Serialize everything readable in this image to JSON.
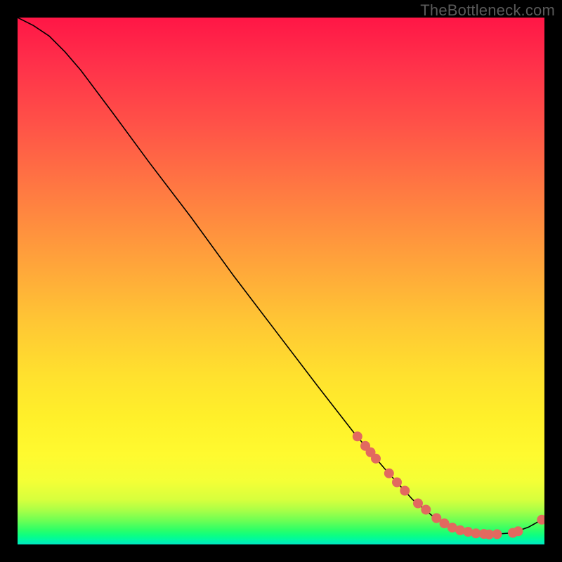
{
  "watermark": "TheBottleneck.com",
  "chart_data": {
    "type": "line",
    "title": "",
    "xlabel": "",
    "ylabel": "",
    "xlim": [
      0,
      100
    ],
    "ylim": [
      0,
      100
    ],
    "curve": [
      {
        "x": 0,
        "y": 100
      },
      {
        "x": 3,
        "y": 98.5
      },
      {
        "x": 6,
        "y": 96.5
      },
      {
        "x": 9,
        "y": 93.5
      },
      {
        "x": 12,
        "y": 90
      },
      {
        "x": 18,
        "y": 82
      },
      {
        "x": 25,
        "y": 72.5
      },
      {
        "x": 33,
        "y": 62
      },
      {
        "x": 41,
        "y": 51
      },
      {
        "x": 49,
        "y": 40.5
      },
      {
        "x": 57,
        "y": 30
      },
      {
        "x": 64,
        "y": 21
      },
      {
        "x": 70,
        "y": 14
      },
      {
        "x": 75,
        "y": 8.5
      },
      {
        "x": 79,
        "y": 5.2
      },
      {
        "x": 82.5,
        "y": 3.2
      },
      {
        "x": 86,
        "y": 2.2
      },
      {
        "x": 90,
        "y": 1.9
      },
      {
        "x": 94,
        "y": 2.2
      },
      {
        "x": 97,
        "y": 3.3
      },
      {
        "x": 99.5,
        "y": 4.7
      }
    ],
    "markers": [
      {
        "x": 64.5,
        "y": 20.5
      },
      {
        "x": 66.0,
        "y": 18.7
      },
      {
        "x": 67.0,
        "y": 17.5
      },
      {
        "x": 68.0,
        "y": 16.3
      },
      {
        "x": 70.5,
        "y": 13.5
      },
      {
        "x": 72.0,
        "y": 11.8
      },
      {
        "x": 73.5,
        "y": 10.2
      },
      {
        "x": 76.0,
        "y": 7.8
      },
      {
        "x": 77.5,
        "y": 6.6
      },
      {
        "x": 79.5,
        "y": 5.0
      },
      {
        "x": 81.0,
        "y": 4.0
      },
      {
        "x": 82.5,
        "y": 3.2
      },
      {
        "x": 84.0,
        "y": 2.7
      },
      {
        "x": 85.5,
        "y": 2.4
      },
      {
        "x": 87.0,
        "y": 2.1
      },
      {
        "x": 88.5,
        "y": 2.0
      },
      {
        "x": 89.5,
        "y": 1.9
      },
      {
        "x": 91.0,
        "y": 1.95
      },
      {
        "x": 94.0,
        "y": 2.2
      },
      {
        "x": 95.0,
        "y": 2.5
      },
      {
        "x": 99.5,
        "y": 4.7
      }
    ],
    "marker_color": "#e2695f",
    "line_color": "#000000"
  }
}
